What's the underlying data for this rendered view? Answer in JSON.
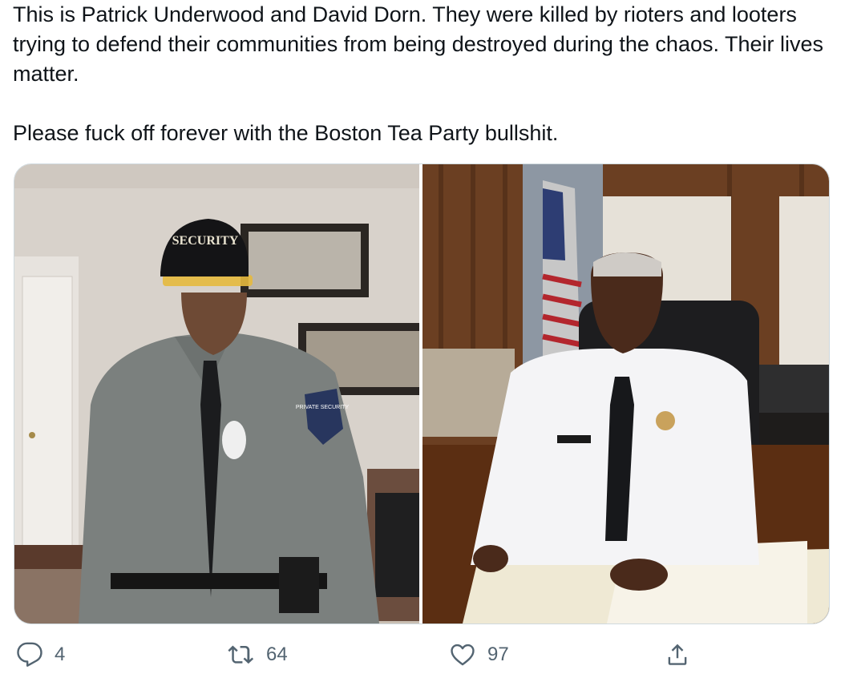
{
  "tweet": {
    "text_line1": "This is Patrick Underwood and David Dorn. They were killed by rioters and looters trying to defend their communities from being destroyed during the chaos. Their lives matter.",
    "text_line2": "Please fuck off forever with the Boston Tea Party bullshit.",
    "images": [
      {
        "name": "photo-security-guard",
        "cap_text": "SECURITY",
        "patch_text": "PRIVATE SECURITY"
      },
      {
        "name": "photo-police-officer"
      }
    ]
  },
  "actions": {
    "reply_count": "4",
    "retweet_count": "64",
    "like_count": "97",
    "icons": [
      "reply-icon",
      "retweet-icon",
      "like-icon",
      "share-icon"
    ]
  },
  "colors": {
    "text": "#0f1419",
    "action_gray": "#536471",
    "border": "#cfd9de"
  }
}
